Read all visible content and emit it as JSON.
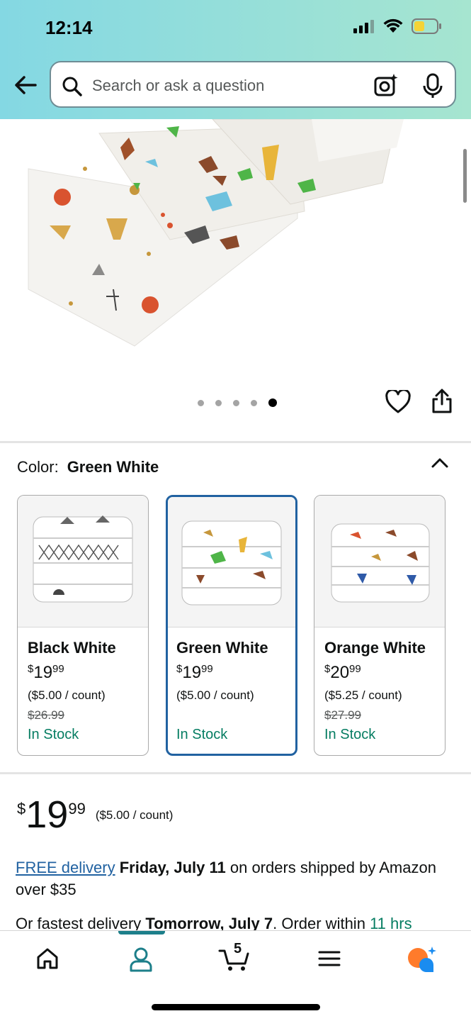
{
  "status_bar": {
    "time": "12:14"
  },
  "search": {
    "placeholder": "Search or ask a question"
  },
  "gallery": {
    "image_count": 5,
    "active_index": 4
  },
  "color_selector": {
    "label": "Color:",
    "selected": "Green White",
    "options": [
      {
        "name": "Black White",
        "price_symbol": "$",
        "price_dollars": "19",
        "price_cents": "99",
        "unit_price": "($5.00 / count)",
        "list_price": "$26.99",
        "stock": "In Stock",
        "selected": false
      },
      {
        "name": "Green White",
        "price_symbol": "$",
        "price_dollars": "19",
        "price_cents": "99",
        "unit_price": "($5.00 / count)",
        "list_price": "",
        "stock": "In Stock",
        "selected": true
      },
      {
        "name": "Orange White",
        "price_symbol": "$",
        "price_dollars": "20",
        "price_cents": "99",
        "unit_price": "($5.25 / count)",
        "list_price": "$27.99",
        "stock": "In Stock",
        "selected": false
      }
    ]
  },
  "price": {
    "symbol": "$",
    "dollars": "19",
    "cents": "99",
    "unit": "($5.00 / count)"
  },
  "delivery": {
    "link": "FREE delivery",
    "date": "Friday, July 11",
    "text": "on orders shipped by Amazon over $35"
  },
  "fastest": {
    "prefix": "Or fastest delivery",
    "date": "Tomorrow, July 7",
    "middle": ". Order within",
    "countdown": "11 hrs"
  },
  "bottom_nav": {
    "cart_count": "5",
    "items": [
      "home-icon",
      "account-icon",
      "cart-icon",
      "menu-icon",
      "rufus-icon"
    ],
    "active": "account-icon"
  },
  "colors": {
    "link": "#2162a1",
    "in_stock": "#067d62",
    "selected_border": "#2162a1",
    "accent_teal": "#1d7f8a",
    "rufus_orange": "#ff7b2b",
    "rufus_blue": "#1a8cf0"
  }
}
